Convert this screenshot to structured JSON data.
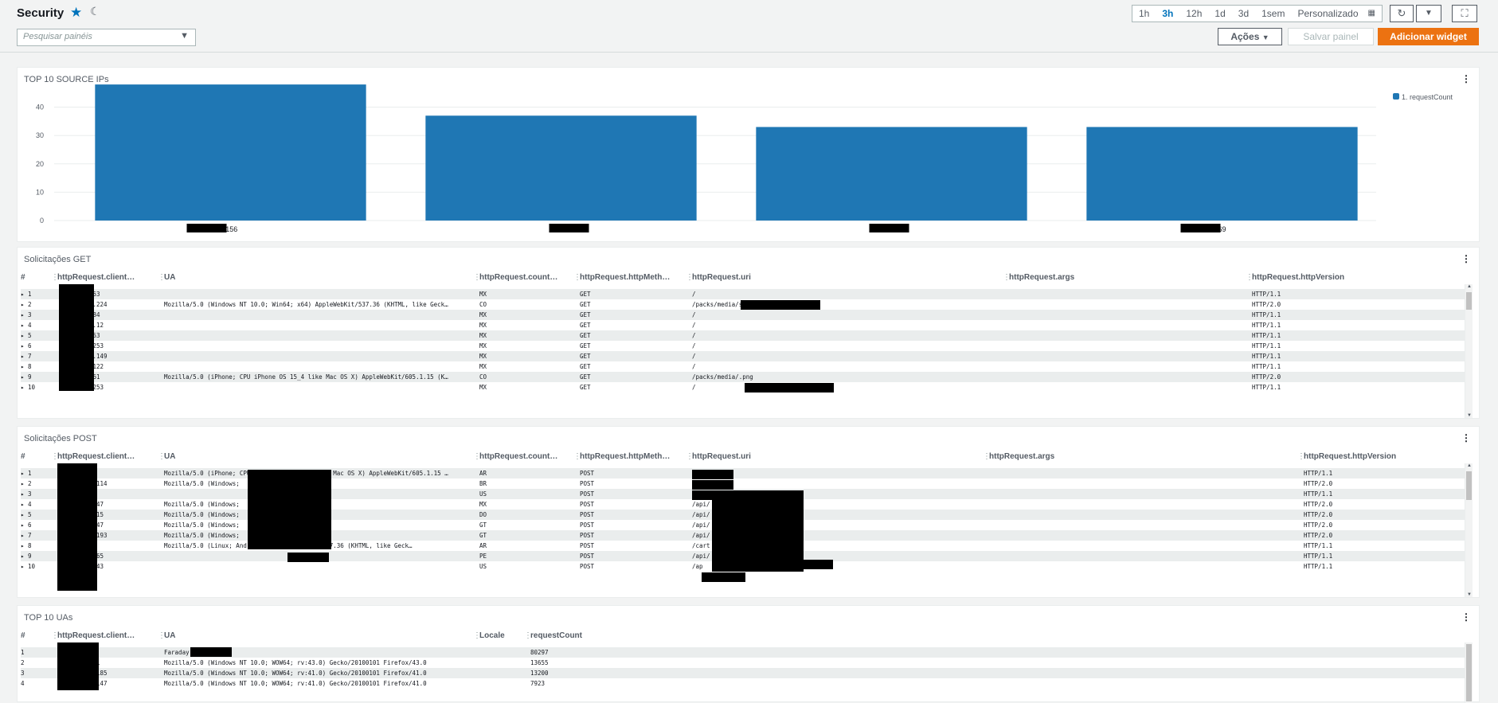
{
  "header": {
    "title": "Security",
    "search_placeholder": "Pesquisar painéis",
    "time_ranges": [
      "1h",
      "3h",
      "12h",
      "1d",
      "3d",
      "1sem"
    ],
    "selected_range": "3h",
    "custom_label": "Personalizado",
    "actions_label": "Ações",
    "save_label": "Salvar painel",
    "add_widget_label": "Adicionar widget"
  },
  "colors": {
    "accent": "#0073bb",
    "bar": "#1f77b4",
    "primary_button": "#ec7211"
  },
  "widgets": {
    "top_ips": {
      "title": "TOP 10 SOURCE IPs",
      "legend": "1. requestCount",
      "chart_data": {
        "type": "bar",
        "categories": [
          "██████.156",
          "191.██████",
          "██████5",
          "██████69"
        ],
        "series": [
          {
            "name": "1. requestCount",
            "values": [
              48,
              37,
              33,
              33
            ]
          }
        ],
        "yticks": [
          0,
          10,
          20,
          30,
          40
        ],
        "ylim": [
          0,
          50
        ],
        "grid": true,
        "legend_position": "top-right"
      }
    },
    "get_requests": {
      "title": "Solicitações GET",
      "columns": [
        "#",
        "httpRequest.client…",
        "UA",
        "httpRequest.count…",
        "httpRequest.httpMeth…",
        "httpRequest.uri",
        "httpRequest.args",
        "httpRequest.httpVersion"
      ],
      "rows": [
        [
          "1",
          ".53",
          "",
          "MX",
          "GET",
          "/",
          "",
          "HTTP/1.1"
        ],
        [
          "2",
          "0.224",
          "Mozilla/5.0 (Windows NT 10.0; Win64; x64) AppleWebKit/537.36 (KHTML, like Geck…",
          "CO",
          "GET",
          "/packs/media/svg",
          "",
          "HTTP/2.0"
        ],
        [
          "3",
          ".84",
          "",
          "MX",
          "GET",
          "/",
          "",
          "HTTP/1.1"
        ],
        [
          "4",
          "6.12",
          "",
          "MX",
          "GET",
          "/",
          "",
          "HTTP/1.1"
        ],
        [
          "5",
          ".53",
          "",
          "MX",
          "GET",
          "/",
          "",
          "HTTP/1.1"
        ],
        [
          "6",
          ".253",
          "",
          "MX",
          "GET",
          "/",
          "",
          "HTTP/1.1"
        ],
        [
          "7",
          "4.149",
          "",
          "MX",
          "GET",
          "/",
          "",
          "HTTP/1.1"
        ],
        [
          "8",
          ".122",
          "",
          "MX",
          "GET",
          "/",
          "",
          "HTTP/1.1"
        ],
        [
          "9",
          ".61",
          "Mozilla/5.0 (iPhone; CPU iPhone OS 15_4 like Mac OS X) AppleWebKit/605.1.15 (K…",
          "CO",
          "GET",
          "/packs/media/.png",
          "",
          "HTTP/2.0"
        ],
        [
          "10",
          ".253",
          "",
          "MX",
          "GET",
          "/",
          "",
          "HTTP/1.1"
        ]
      ]
    },
    "post_requests": {
      "title": "Solicitações POST",
      "columns": [
        "#",
        "httpRequest.client…",
        "UA",
        "httpRequest.count…",
        "httpRequest.httpMeth…",
        "httpRequest.uri",
        "httpRequest.args",
        "httpRequest.httpVersion"
      ],
      "rows": [
        [
          "1",
          "83",
          "Mozilla/5.0 (iPhone; CPU iPhone OS 15_4_1 like Mac OS X) AppleWebKit/605.1.15 …",
          "AR",
          "POST",
          "person",
          "",
          "HTTP/1.1"
        ],
        [
          "2",
          "5.114",
          "Mozilla/5.0 (Windows;",
          "BR",
          "POST",
          "us",
          "",
          "HTTP/2.0"
        ],
        [
          "3",
          "7",
          "",
          "US",
          "POST",
          "",
          "",
          "HTTP/1.1"
        ],
        [
          "4",
          "5.47",
          "Mozilla/5.0 (Windows;",
          "MX",
          "POST",
          "/api/",
          "",
          "HTTP/2.0"
        ],
        [
          "5",
          ".115",
          "Mozilla/5.0 (Windows;",
          "DO",
          "POST",
          "/api/",
          "",
          "HTTP/2.0"
        ],
        [
          "6",
          "1.47",
          "Mozilla/5.0 (Windows;",
          "GT",
          "POST",
          "/api/",
          "",
          "HTTP/2.0"
        ],
        [
          "7",
          "7.193",
          "Mozilla/5.0 (Windows;",
          "GT",
          "POST",
          "/api/",
          "",
          "HTTP/2.0"
        ],
        [
          "8",
          "83",
          "Mozilla/5.0 (Linux; Android 11; AppleWebKit/537.36 (KHTML, like Geck…",
          "AR",
          "POST",
          "/cart",
          "",
          "HTTP/1.1"
        ],
        [
          "9",
          "7.65",
          "",
          "PE",
          "POST",
          "/api/",
          "",
          "HTTP/1.1"
        ],
        [
          "10",
          ".243",
          "",
          "US",
          "POST",
          "/ap",
          "",
          "HTTP/1.1"
        ]
      ]
    },
    "top_uas": {
      "title": "TOP 10 UAs",
      "columns": [
        "#",
        "httpRequest.client…",
        "UA",
        "Locale",
        "requestCount"
      ],
      "rows": [
        [
          "1",
          "7",
          "Faraday",
          "",
          "80297"
        ],
        [
          "2",
          ".51",
          "Mozilla/5.0 (Windows NT 10.0; WOW64; rv:43.0) Gecko/20100101 Firefox/43.0",
          "",
          "13655"
        ],
        [
          "3",
          "4.185",
          "Mozilla/5.0 (Windows NT 10.0; WOW64; rv:41.0) Gecko/20100101 Firefox/41.0",
          "",
          "13200"
        ],
        [
          "4",
          "2.147",
          "Mozilla/5.0 (Windows NT 10.0; WOW64; rv:41.0) Gecko/20100101 Firefox/41.0",
          "",
          "7923"
        ]
      ]
    }
  }
}
